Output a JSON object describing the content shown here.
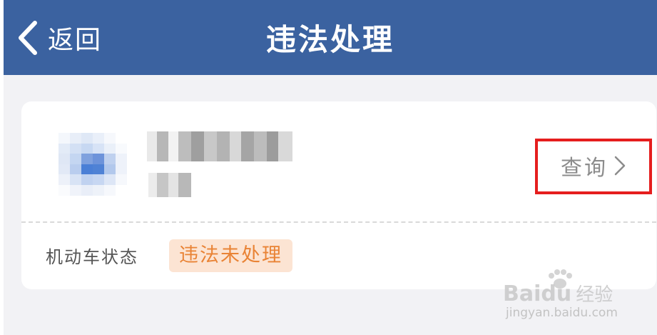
{
  "header": {
    "back_label": "返回",
    "title": "违法处理"
  },
  "vehicle_card": {
    "query_label": "查询",
    "status_label": "机动车状态",
    "status_value": "违法未处理"
  },
  "watermark": {
    "brand_left": "Bai",
    "brand_right": "du",
    "brand_suffix": "经验",
    "url": "jingyan.baidu.com"
  },
  "colors": {
    "header_bg": "#3b62a0",
    "highlight_border": "#e51e1e",
    "status_badge_bg": "#fce4d3",
    "status_badge_text": "#e98335"
  },
  "icons": {
    "back": "chevron-left-icon",
    "query_arrow": "chevron-right-icon",
    "watermark_paw": "paw-icon"
  }
}
